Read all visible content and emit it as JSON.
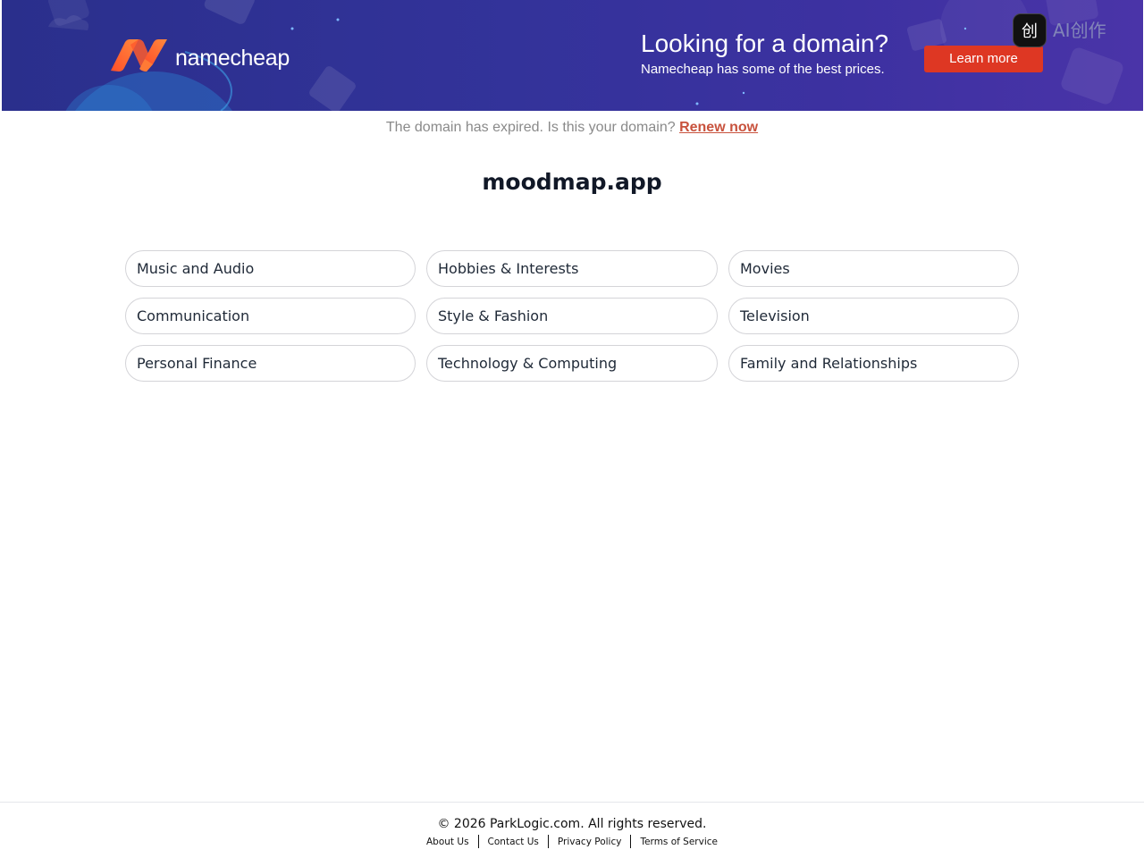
{
  "banner": {
    "brand_name": "namecheap",
    "promo_title": "Looking for a domain?",
    "promo_subtitle": "Namecheap has some of the best prices.",
    "cta_label": "Learn more",
    "watermark_glyph": "创",
    "watermark_text": "AI创作",
    "colors": {
      "background": "#2f3396",
      "brand_orange": "#ff6a2b",
      "cta": "#de3723"
    }
  },
  "notice": {
    "text": "The domain has expired. Is this your domain?",
    "link_label": "Renew now",
    "link_color": "#c8523d"
  },
  "domain": {
    "name": "moodmap.app"
  },
  "categories": [
    {
      "label": "Music and Audio"
    },
    {
      "label": "Hobbies & Interests"
    },
    {
      "label": "Movies"
    },
    {
      "label": "Communication"
    },
    {
      "label": "Style & Fashion"
    },
    {
      "label": "Television"
    },
    {
      "label": "Personal Finance"
    },
    {
      "label": "Technology & Computing"
    },
    {
      "label": "Family and Relationships"
    }
  ],
  "footer": {
    "copyright": "© 2026 ParkLogic.com. All rights reserved.",
    "links": [
      {
        "label": "About Us"
      },
      {
        "label": "Contact Us"
      },
      {
        "label": "Privacy Policy"
      },
      {
        "label": "Terms of Service"
      }
    ]
  }
}
